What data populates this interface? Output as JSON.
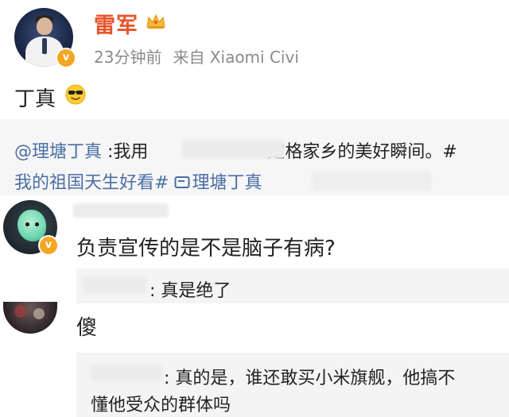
{
  "post": {
    "author": "雷军",
    "time": "23分钟前",
    "source": "来自 Xiaomi Civi",
    "text": "丁真",
    "verified_badge": "v",
    "icons": {
      "crown": "crown-icon",
      "emoji": "cool-sunglasses-emoji"
    },
    "name_color": "#e8542a"
  },
  "repost": {
    "mention": "@理塘丁真",
    "line1_a": " :我用",
    "line1_b": "定格家乡的美好瞬间。#",
    "line2_hashtag": "我的祖国天生好看#",
    "line2_link_icon": "link-icon",
    "line2_link": "理塘丁真"
  },
  "comments": [
    {
      "text": "负责宣传的是不是脑子有病?",
      "verified_badge": "v",
      "reply": {
        "text": ": 真是绝了"
      }
    },
    {
      "text": "傻",
      "reply": {
        "line1": ": 真的是，谁还敢买小米旗舰，他搞不",
        "line2": "懂他受众的群体吗"
      }
    }
  ],
  "colors": {
    "link": "#4a6fa5",
    "meta": "#8a8a8a",
    "badge": "#f5a623",
    "panel": "#f6f6f6"
  }
}
